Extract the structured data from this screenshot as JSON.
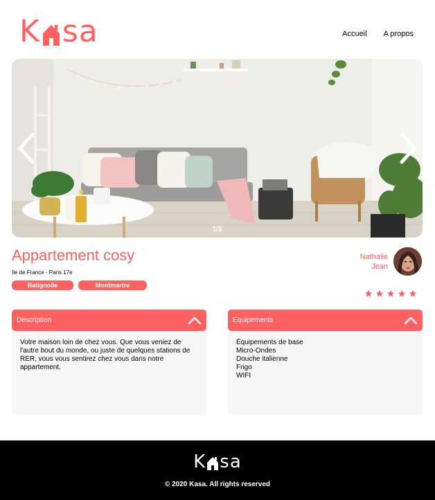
{
  "brand": {
    "logo_left": "K",
    "logo_right": "sa",
    "accent_color": "#FF6060"
  },
  "nav": {
    "items": [
      {
        "label": "Accueil"
      },
      {
        "label": "A propos"
      }
    ]
  },
  "carousel": {
    "counter": "1/5",
    "prev_icon": "chevron-left-icon",
    "next_icon": "chevron-right-icon"
  },
  "listing": {
    "title": "Appartement cosy",
    "location": "Ile de France - Paris 17e",
    "tags": [
      "Batignolle",
      "Montmartre"
    ],
    "host": {
      "first_name": "Nathalie",
      "last_name": "Jean"
    },
    "rating": 5,
    "rating_max": 5
  },
  "description": {
    "header": "Description",
    "text": "Votre maison loin de chez vous. Que vous veniez de l'autre bout du monde, ou juste de quelques stations de RER, vous vous sentirez chez vous dans notre appartement."
  },
  "equipments": {
    "header": "Equipements",
    "items": [
      "Équipements de base",
      "Micro-Ondes",
      "Douche italienne",
      "Frigo",
      "WIFI"
    ]
  },
  "footer": {
    "copyright": "© 2020 Kasa. All rights reserved"
  }
}
